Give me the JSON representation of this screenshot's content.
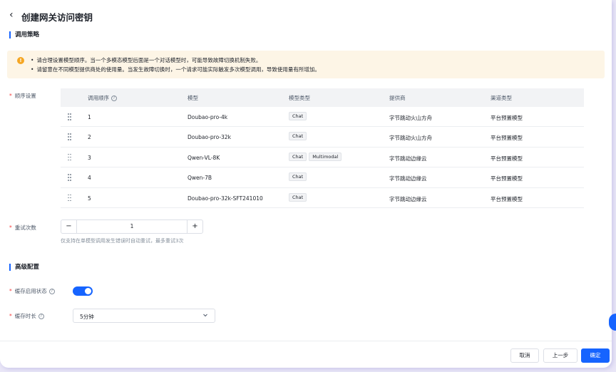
{
  "header": {
    "title": "创建网关访问密钥"
  },
  "sections": {
    "policy": "调用策略",
    "advanced": "高级配置"
  },
  "alert": {
    "line1": "请合理设置模型顺序。当一个多模态模型后面是一个对话模型时，可能导致故障切换机制失败。",
    "line2": "请留意在不同模型提供商处的使用量。当发生故障切换时，一个请求可能实际触发多次模型调用，导致使用量有所增加。"
  },
  "order": {
    "label": "顺序设置",
    "columns": [
      "调用顺序",
      "模型",
      "模型类型",
      "提供商",
      "渠道类型"
    ],
    "rows": [
      {
        "order": "1",
        "model": "Doubao-pro-4k",
        "types": [
          "Chat"
        ],
        "provider": "字节跳动火山方舟",
        "channel": "平台预置模型"
      },
      {
        "order": "2",
        "model": "Doubao-pro-32k",
        "types": [
          "Chat"
        ],
        "provider": "字节跳动火山方舟",
        "channel": "平台预置模型"
      },
      {
        "order": "3",
        "model": "Qwen-VL-8K",
        "types": [
          "Chat",
          "Multimodal"
        ],
        "provider": "字节跳动边缘云",
        "channel": "平台预置模型"
      },
      {
        "order": "4",
        "model": "Qwen-7B",
        "types": [
          "Chat"
        ],
        "provider": "字节跳动边缘云",
        "channel": "平台预置模型"
      },
      {
        "order": "5",
        "model": "Doubao-pro-32k-SFT241010",
        "types": [
          "Chat"
        ],
        "provider": "字节跳动边缘云",
        "channel": "平台预置模型"
      }
    ]
  },
  "retry": {
    "label": "重试次数",
    "value": "1",
    "minus": "−",
    "plus": "+",
    "hint": "仅支持在单模型调用发生错误时自动重试，最多重试3次"
  },
  "cache": {
    "status_label": "缓存启用状态",
    "enabled": true,
    "duration_label": "缓存时长",
    "duration_value": "5分钟"
  },
  "footer": {
    "cancel": "取消",
    "prev": "上一步",
    "ok": "确定"
  },
  "colors": {
    "accent": "#1664ff",
    "warning": "#f5a623",
    "required": "#f53f3f"
  }
}
